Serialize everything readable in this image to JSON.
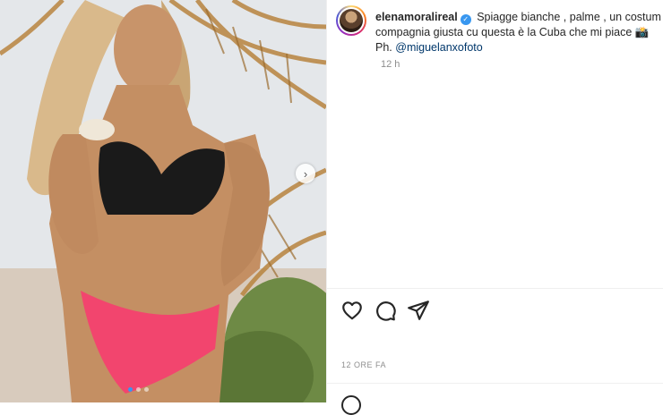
{
  "post": {
    "username": "elenamoralireal",
    "verified_icon": "verified-badge-icon",
    "caption_line1": "Spiagge bianche , palme , un costum",
    "caption_line2": "compagnia giusta cu questa è la Cuba che mi piace 📸",
    "caption_line3_prefix": "Ph. ",
    "mention": "@miguelanxofoto",
    "time_ago": "12 h",
    "date_label": "12 ORE FA"
  },
  "actions": {
    "like_icon": "heart-icon",
    "comment_icon": "comment-icon",
    "share_icon": "share-icon"
  },
  "carousel": {
    "next_icon": "chevron-right-icon",
    "next_glyph": "›",
    "slides_count": 3,
    "active_index": 0
  },
  "colors": {
    "accent_blue": "#3897f0",
    "mention": "#00376b",
    "muted": "#8e8e8e",
    "text": "#262626"
  }
}
